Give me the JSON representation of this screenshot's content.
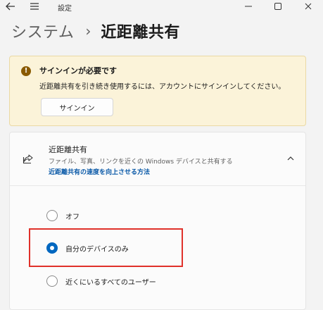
{
  "window": {
    "title": "設定"
  },
  "breadcrumb": {
    "parent": "システム",
    "separator": "›",
    "current": "近距離共有"
  },
  "warning": {
    "title": "サインインが必要です",
    "body": "近距離共有を引き続き使用するには、アカウントにサインインしてください。",
    "button_label": "サインイン",
    "icon": "warning-icon",
    "color": "#fbf3d9"
  },
  "nearby_sharing": {
    "title": "近距離共有",
    "description": "ファイル、写真、リンクを近くの Windows デバイスと共有する",
    "link": "近距離共有の速度を向上させる方法",
    "icon": "share-icon",
    "expanded": true,
    "options": [
      {
        "label": "オフ",
        "selected": false
      },
      {
        "label": "自分のデバイスのみ",
        "selected": true
      },
      {
        "label": "近くにいるすべてのユーザー",
        "selected": false
      }
    ]
  },
  "colors": {
    "accent": "#0067c0",
    "link": "#0b5aa8",
    "highlight": "#e0312a"
  }
}
